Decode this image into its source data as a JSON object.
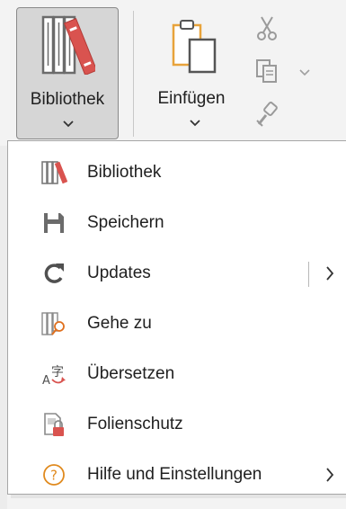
{
  "ribbon": {
    "library_button": {
      "label": "Bibliothek",
      "icon": "library-books-icon",
      "has_dropdown": true
    },
    "paste_button": {
      "label": "Einfügen",
      "icon": "clipboard-paste-icon",
      "has_dropdown": true
    },
    "tools": [
      {
        "icon": "scissors-icon",
        "name": "cut"
      },
      {
        "icon": "copy-icon",
        "name": "copy"
      },
      {
        "icon": "format-painter-icon",
        "name": "format-painter"
      }
    ]
  },
  "menu": {
    "items": [
      {
        "label": "Bibliothek",
        "icon": "library-books-icon",
        "submenu": false
      },
      {
        "label": "Speichern",
        "icon": "save-icon",
        "submenu": false
      },
      {
        "label": "Updates",
        "icon": "refresh-icon",
        "submenu": true,
        "split": true
      },
      {
        "label": "Gehe zu",
        "icon": "library-search-icon",
        "submenu": false
      },
      {
        "label": "Übersetzen",
        "icon": "translate-icon",
        "submenu": false
      },
      {
        "label": "Folienschutz",
        "icon": "slide-lock-icon",
        "submenu": false
      },
      {
        "label": "Hilfe und Einstellungen",
        "icon": "help-icon",
        "submenu": true
      }
    ]
  },
  "colors": {
    "accent_red": "#d9534f",
    "icon_gray": "#6b6b6b",
    "paste_orange": "#e8a33b",
    "help_orange": "#e08a1e"
  }
}
